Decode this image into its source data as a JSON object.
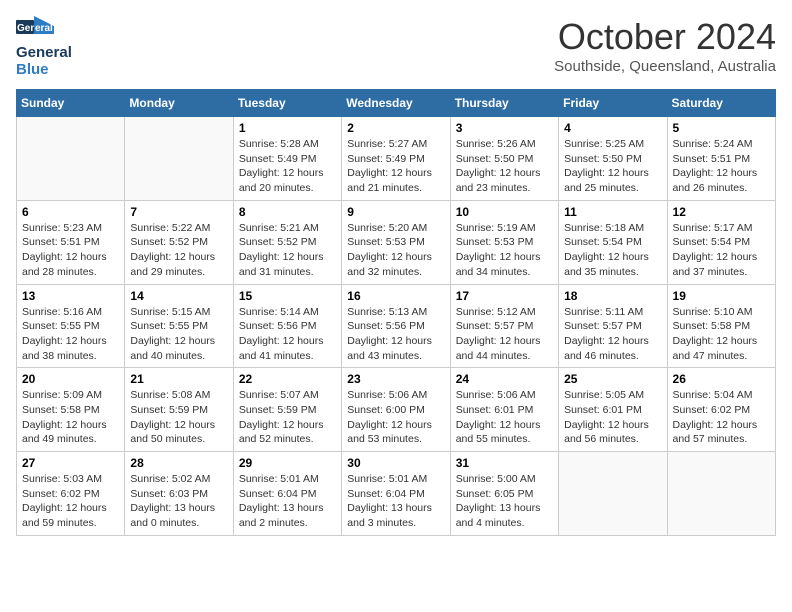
{
  "header": {
    "logo_line1": "General",
    "logo_line2": "Blue",
    "month": "October 2024",
    "location": "Southside, Queensland, Australia"
  },
  "weekdays": [
    "Sunday",
    "Monday",
    "Tuesday",
    "Wednesday",
    "Thursday",
    "Friday",
    "Saturday"
  ],
  "weeks": [
    [
      {
        "day": "",
        "sunrise": "",
        "sunset": "",
        "daylight": ""
      },
      {
        "day": "",
        "sunrise": "",
        "sunset": "",
        "daylight": ""
      },
      {
        "day": "1",
        "sunrise": "Sunrise: 5:28 AM",
        "sunset": "Sunset: 5:49 PM",
        "daylight": "Daylight: 12 hours and 20 minutes."
      },
      {
        "day": "2",
        "sunrise": "Sunrise: 5:27 AM",
        "sunset": "Sunset: 5:49 PM",
        "daylight": "Daylight: 12 hours and 21 minutes."
      },
      {
        "day": "3",
        "sunrise": "Sunrise: 5:26 AM",
        "sunset": "Sunset: 5:50 PM",
        "daylight": "Daylight: 12 hours and 23 minutes."
      },
      {
        "day": "4",
        "sunrise": "Sunrise: 5:25 AM",
        "sunset": "Sunset: 5:50 PM",
        "daylight": "Daylight: 12 hours and 25 minutes."
      },
      {
        "day": "5",
        "sunrise": "Sunrise: 5:24 AM",
        "sunset": "Sunset: 5:51 PM",
        "daylight": "Daylight: 12 hours and 26 minutes."
      }
    ],
    [
      {
        "day": "6",
        "sunrise": "Sunrise: 5:23 AM",
        "sunset": "Sunset: 5:51 PM",
        "daylight": "Daylight: 12 hours and 28 minutes."
      },
      {
        "day": "7",
        "sunrise": "Sunrise: 5:22 AM",
        "sunset": "Sunset: 5:52 PM",
        "daylight": "Daylight: 12 hours and 29 minutes."
      },
      {
        "day": "8",
        "sunrise": "Sunrise: 5:21 AM",
        "sunset": "Sunset: 5:52 PM",
        "daylight": "Daylight: 12 hours and 31 minutes."
      },
      {
        "day": "9",
        "sunrise": "Sunrise: 5:20 AM",
        "sunset": "Sunset: 5:53 PM",
        "daylight": "Daylight: 12 hours and 32 minutes."
      },
      {
        "day": "10",
        "sunrise": "Sunrise: 5:19 AM",
        "sunset": "Sunset: 5:53 PM",
        "daylight": "Daylight: 12 hours and 34 minutes."
      },
      {
        "day": "11",
        "sunrise": "Sunrise: 5:18 AM",
        "sunset": "Sunset: 5:54 PM",
        "daylight": "Daylight: 12 hours and 35 minutes."
      },
      {
        "day": "12",
        "sunrise": "Sunrise: 5:17 AM",
        "sunset": "Sunset: 5:54 PM",
        "daylight": "Daylight: 12 hours and 37 minutes."
      }
    ],
    [
      {
        "day": "13",
        "sunrise": "Sunrise: 5:16 AM",
        "sunset": "Sunset: 5:55 PM",
        "daylight": "Daylight: 12 hours and 38 minutes."
      },
      {
        "day": "14",
        "sunrise": "Sunrise: 5:15 AM",
        "sunset": "Sunset: 5:55 PM",
        "daylight": "Daylight: 12 hours and 40 minutes."
      },
      {
        "day": "15",
        "sunrise": "Sunrise: 5:14 AM",
        "sunset": "Sunset: 5:56 PM",
        "daylight": "Daylight: 12 hours and 41 minutes."
      },
      {
        "day": "16",
        "sunrise": "Sunrise: 5:13 AM",
        "sunset": "Sunset: 5:56 PM",
        "daylight": "Daylight: 12 hours and 43 minutes."
      },
      {
        "day": "17",
        "sunrise": "Sunrise: 5:12 AM",
        "sunset": "Sunset: 5:57 PM",
        "daylight": "Daylight: 12 hours and 44 minutes."
      },
      {
        "day": "18",
        "sunrise": "Sunrise: 5:11 AM",
        "sunset": "Sunset: 5:57 PM",
        "daylight": "Daylight: 12 hours and 46 minutes."
      },
      {
        "day": "19",
        "sunrise": "Sunrise: 5:10 AM",
        "sunset": "Sunset: 5:58 PM",
        "daylight": "Daylight: 12 hours and 47 minutes."
      }
    ],
    [
      {
        "day": "20",
        "sunrise": "Sunrise: 5:09 AM",
        "sunset": "Sunset: 5:58 PM",
        "daylight": "Daylight: 12 hours and 49 minutes."
      },
      {
        "day": "21",
        "sunrise": "Sunrise: 5:08 AM",
        "sunset": "Sunset: 5:59 PM",
        "daylight": "Daylight: 12 hours and 50 minutes."
      },
      {
        "day": "22",
        "sunrise": "Sunrise: 5:07 AM",
        "sunset": "Sunset: 5:59 PM",
        "daylight": "Daylight: 12 hours and 52 minutes."
      },
      {
        "day": "23",
        "sunrise": "Sunrise: 5:06 AM",
        "sunset": "Sunset: 6:00 PM",
        "daylight": "Daylight: 12 hours and 53 minutes."
      },
      {
        "day": "24",
        "sunrise": "Sunrise: 5:06 AM",
        "sunset": "Sunset: 6:01 PM",
        "daylight": "Daylight: 12 hours and 55 minutes."
      },
      {
        "day": "25",
        "sunrise": "Sunrise: 5:05 AM",
        "sunset": "Sunset: 6:01 PM",
        "daylight": "Daylight: 12 hours and 56 minutes."
      },
      {
        "day": "26",
        "sunrise": "Sunrise: 5:04 AM",
        "sunset": "Sunset: 6:02 PM",
        "daylight": "Daylight: 12 hours and 57 minutes."
      }
    ],
    [
      {
        "day": "27",
        "sunrise": "Sunrise: 5:03 AM",
        "sunset": "Sunset: 6:02 PM",
        "daylight": "Daylight: 12 hours and 59 minutes."
      },
      {
        "day": "28",
        "sunrise": "Sunrise: 5:02 AM",
        "sunset": "Sunset: 6:03 PM",
        "daylight": "Daylight: 13 hours and 0 minutes."
      },
      {
        "day": "29",
        "sunrise": "Sunrise: 5:01 AM",
        "sunset": "Sunset: 6:04 PM",
        "daylight": "Daylight: 13 hours and 2 minutes."
      },
      {
        "day": "30",
        "sunrise": "Sunrise: 5:01 AM",
        "sunset": "Sunset: 6:04 PM",
        "daylight": "Daylight: 13 hours and 3 minutes."
      },
      {
        "day": "31",
        "sunrise": "Sunrise: 5:00 AM",
        "sunset": "Sunset: 6:05 PM",
        "daylight": "Daylight: 13 hours and 4 minutes."
      },
      {
        "day": "",
        "sunrise": "",
        "sunset": "",
        "daylight": ""
      },
      {
        "day": "",
        "sunrise": "",
        "sunset": "",
        "daylight": ""
      }
    ]
  ]
}
